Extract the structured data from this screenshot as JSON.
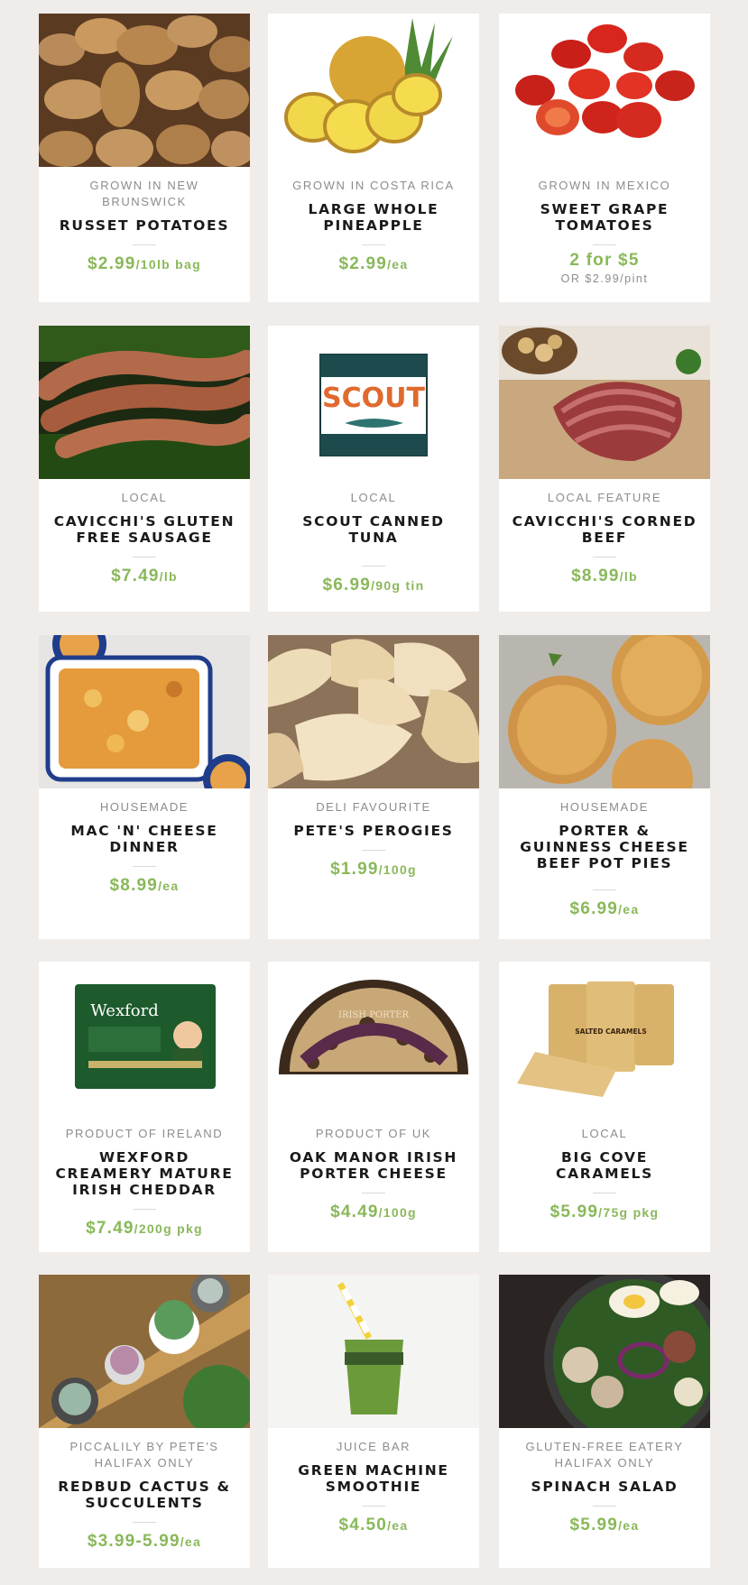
{
  "products": [
    {
      "origin": "GROWN IN NEW BRUNSWICK",
      "name": "RUSSET POTATOES",
      "price": "$2.99",
      "unit": "/10lb bag",
      "image": "potatoes-photo"
    },
    {
      "origin": "GROWN IN COSTA RICA",
      "name": "LARGE WHOLE PINEAPPLE",
      "price": "$2.99",
      "unit": "/ea",
      "image": "pineapple-photo"
    },
    {
      "origin": "GROWN IN MEXICO",
      "name": "SWEET GRAPE TOMATOES",
      "price": "2 for $5",
      "unit": "",
      "note": "OR $2.99/pint",
      "image": "tomatoes-photo"
    },
    {
      "origin": "LOCAL",
      "name": "CAVICCHI'S GLUTEN FREE SAUSAGE",
      "price": "$7.49",
      "unit": "/lb",
      "image": "sausage-photo"
    },
    {
      "origin": "LOCAL",
      "name": "SCOUT CANNED TUNA",
      "price": "$6.99",
      "unit": "/90g tin",
      "image": "scout-tuna-photo",
      "pkg_text": "SCOUT"
    },
    {
      "origin": "LOCAL FEATURE",
      "name": "CAVICCHI'S CORNED BEEF",
      "price": "$8.99",
      "unit": "/lb",
      "image": "corned-beef-photo"
    },
    {
      "origin": "HOUSEMADE",
      "name": "MAC 'N' CHEESE DINNER",
      "price": "$8.99",
      "unit": "/ea",
      "image": "mac-cheese-photo"
    },
    {
      "origin": "DELI FAVOURITE",
      "name": "PETE'S PEROGIES",
      "price": "$1.99",
      "unit": "/100g",
      "image": "perogies-photo"
    },
    {
      "origin": "HOUSEMADE",
      "name": "PORTER & GUINNESS CHEESE BEEF POT PIES",
      "price": "$6.99",
      "unit": "/ea",
      "image": "pot-pies-photo"
    },
    {
      "origin": "PRODUCT OF IRELAND",
      "name": "WEXFORD CREAMERY MATURE IRISH CHEDDAR",
      "price": "$7.49",
      "unit": "/200g pkg",
      "image": "wexford-cheddar-photo",
      "pkg_text": "Wexford"
    },
    {
      "origin": "PRODUCT OF UK",
      "name": "OAK MANOR IRISH PORTER CHEESE",
      "price": "$4.49",
      "unit": "/100g",
      "image": "porter-cheese-photo",
      "pkg_text": "IRISH PORTER"
    },
    {
      "origin": "LOCAL",
      "name": "BIG COVE CARAMELS",
      "price": "$5.99",
      "unit": "/75g pkg",
      "image": "caramels-photo",
      "pkg_text": "SALTED CARAMELS"
    },
    {
      "origin": "PICCALILY BY PETE'S HALIFAX ONLY",
      "name": "REDBUD CACTUS & SUCCULENTS",
      "price": "$3.99-5.99",
      "unit": "/ea",
      "image": "succulents-photo"
    },
    {
      "origin": "JUICE BAR",
      "name": "GREEN MACHINE SMOOTHIE",
      "price": "$4.50",
      "unit": "/ea",
      "image": "smoothie-photo"
    },
    {
      "origin": "GLUTEN-FREE EATERY HALIFAX ONLY",
      "name": "SPINACH SALAD",
      "price": "$5.99",
      "unit": "/ea",
      "image": "spinach-salad-photo"
    }
  ],
  "colors": {
    "background": "#f0ece9",
    "card": "#ffffff",
    "price": "#8ab85a",
    "origin": "#8c8c8c",
    "name": "#1a1a1a"
  }
}
